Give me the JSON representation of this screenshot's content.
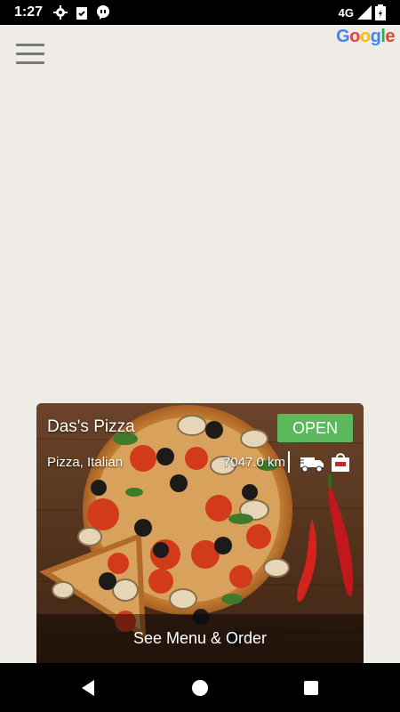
{
  "status_bar": {
    "time": "1:27",
    "network": "4G",
    "icons": [
      "gear-icon",
      "clipboard-check-icon",
      "chat-quote-icon",
      "signal-icon",
      "battery-icon"
    ]
  },
  "map": {
    "provider_logo": [
      "G",
      "o",
      "o",
      "g",
      "l",
      "e"
    ],
    "logo_colors": [
      "#4285F4",
      "#EA4335",
      "#FBBC05",
      "#4285F4",
      "#34A853",
      "#EA4335"
    ]
  },
  "card": {
    "store_name": "Das's Pizza",
    "status": "OPEN",
    "status_color": "#5cb85c",
    "cuisine": "Pizza, Italian",
    "distance": "7047.0 km",
    "action_label": "See Menu & Order",
    "service_icons": [
      "delivery-truck-icon",
      "shopping-bag-icon"
    ]
  },
  "nav": {
    "buttons": [
      "back-icon",
      "home-icon",
      "recents-icon"
    ]
  }
}
